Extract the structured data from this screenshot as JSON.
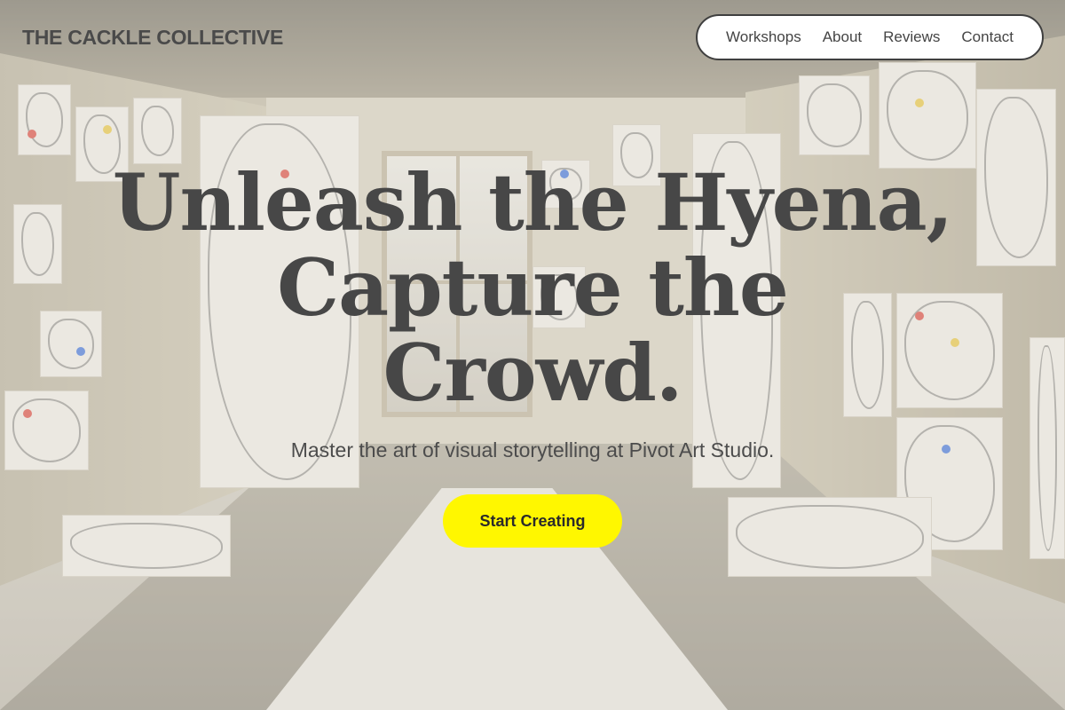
{
  "brand": {
    "name": "THE CACKLE COLLECTIVE"
  },
  "nav": {
    "items": [
      {
        "label": "Workshops"
      },
      {
        "label": "About"
      },
      {
        "label": "Reviews"
      },
      {
        "label": "Contact"
      }
    ]
  },
  "hero": {
    "title_lines": [
      "Unleash the Hyena,",
      "Capture the",
      "Crowd."
    ],
    "subtitle": "Master the art of visual storytelling at Pivot Art Studio.",
    "cta_label": "Start Creating"
  },
  "colors": {
    "cta_background": "#fff700",
    "nav_background": "#ffffff",
    "text_dark": "#474747"
  }
}
